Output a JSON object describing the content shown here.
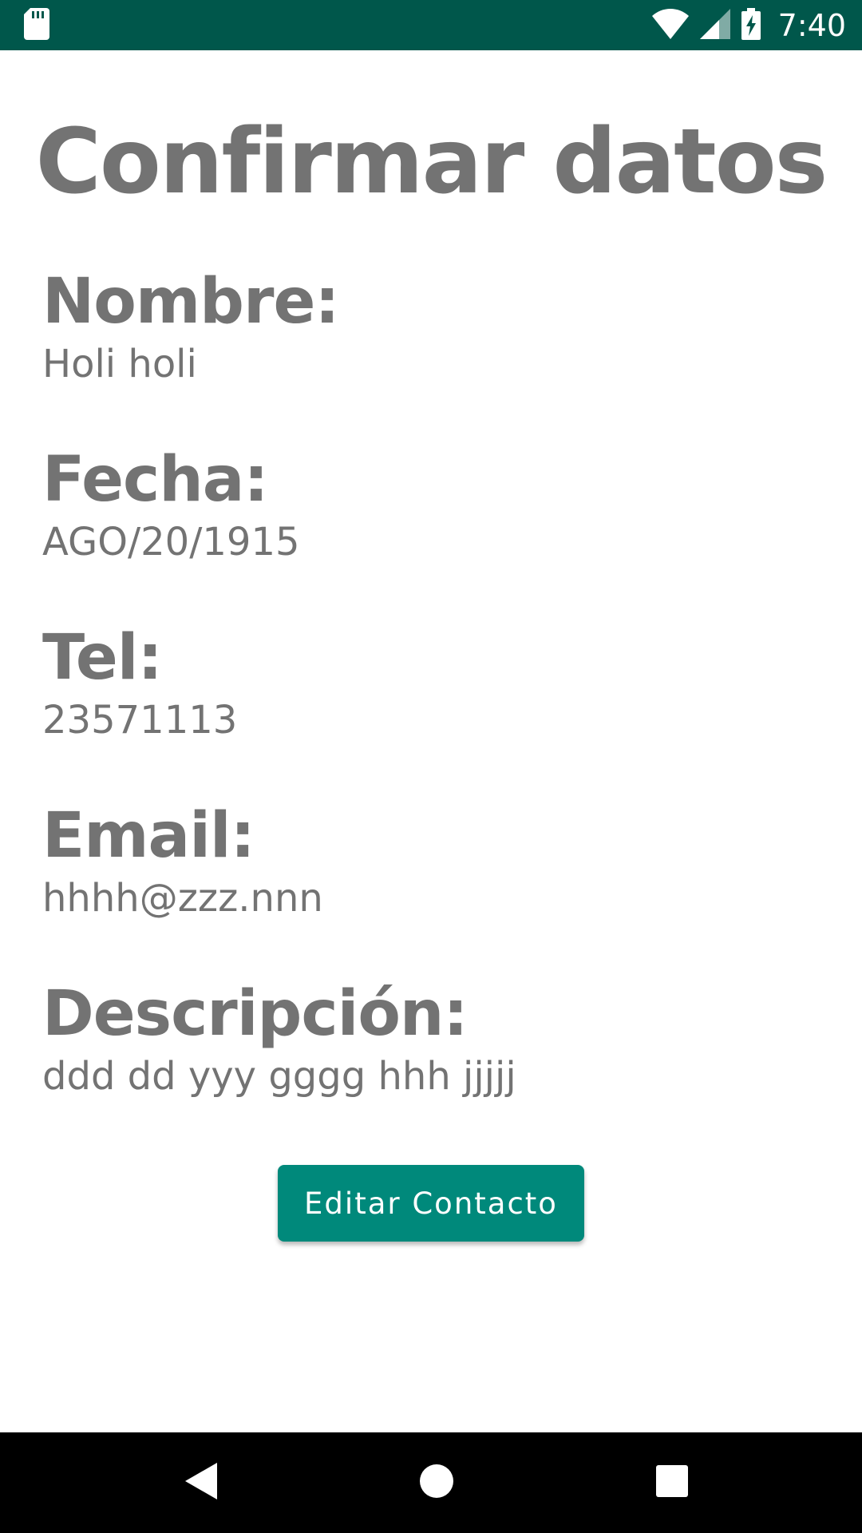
{
  "status_bar": {
    "time": "7:40",
    "icons": [
      "sd-card-icon",
      "wifi-icon",
      "signal-icon",
      "battery-charging-icon"
    ],
    "background": "#00574b"
  },
  "page": {
    "title": "Confirmar datos"
  },
  "fields": [
    {
      "label": "Nombre:",
      "value": "Holi holi"
    },
    {
      "label": "Fecha:",
      "value": "AGO/20/1915"
    },
    {
      "label": "Tel:",
      "value": "23571113"
    },
    {
      "label": "Email:",
      "value": "hhhh@zzz.nnn"
    },
    {
      "label": "Descripción:",
      "value": "ddd dd yyy gggg hhh jjjjj"
    }
  ],
  "actions": {
    "edit_label": "Editar Contacto",
    "accent": "#00897b"
  },
  "nav_bar": {
    "icons": [
      "back-icon",
      "home-icon",
      "recents-icon"
    ]
  }
}
